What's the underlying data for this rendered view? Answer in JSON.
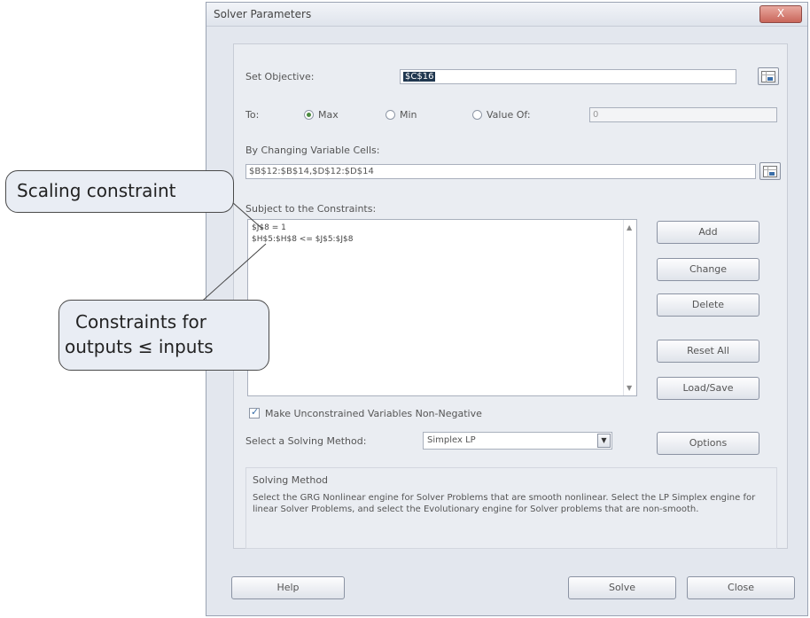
{
  "window": {
    "title": "Solver Parameters",
    "close_label": "X"
  },
  "objective": {
    "label": "Set Objective:",
    "value": "$C$16"
  },
  "to": {
    "label": "To:",
    "options": [
      {
        "label": "Max",
        "selected": true
      },
      {
        "label": "Min",
        "selected": false
      },
      {
        "label": "Value Of:",
        "selected": false
      }
    ],
    "value_of": "0"
  },
  "changing": {
    "label": "By Changing Variable Cells:",
    "value": "$B$12:$B$14,$D$12:$D$14"
  },
  "constraints": {
    "label": "Subject to the Constraints:",
    "items": [
      "$J$8 = 1",
      "$H$5:$H$8 <= $J$5:$J$8"
    ]
  },
  "side_buttons": {
    "add": "Add",
    "change": "Change",
    "delete": "Delete",
    "reset_all": "Reset All",
    "load_save": "Load/Save",
    "options": "Options"
  },
  "nonnegative": {
    "label": "Make Unconstrained Variables Non-Negative",
    "checked": true
  },
  "method": {
    "label": "Select a Solving Method:",
    "value": "Simplex LP"
  },
  "solving_method": {
    "heading": "Solving Method",
    "description": "Select the GRG Nonlinear engine for Solver Problems that are smooth nonlinear. Select the LP Simplex engine for linear Solver Problems, and select the Evolutionary engine for Solver problems that are non-smooth."
  },
  "footer": {
    "help": "Help",
    "solve": "Solve",
    "close": "Close"
  },
  "callouts": {
    "scaling": "Scaling constraint",
    "outputs_line1": "Constraints for",
    "outputs_line2": "outputs ≤ inputs"
  },
  "icons": {
    "range_select": "range-select-icon",
    "dropdown": "chevron-down-icon"
  }
}
